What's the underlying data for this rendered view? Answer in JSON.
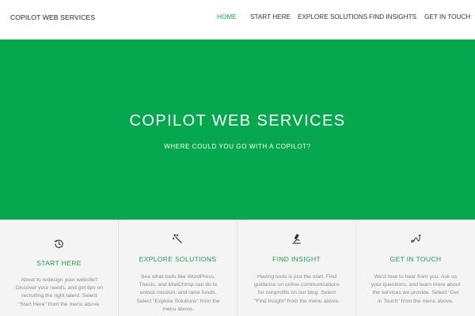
{
  "header": {
    "site_title": "COPILOT WEB SERVICES",
    "nav": [
      {
        "label": "HOME",
        "active": true
      },
      {
        "label": "START HERE",
        "active": false
      },
      {
        "label": "EXPLORE SOLUTIONS",
        "active": false
      },
      {
        "label": "FIND INSIGHTS",
        "active": false
      },
      {
        "label": "GET IN TOUCH",
        "active": false
      }
    ]
  },
  "hero": {
    "title": "COPILOT WEB SERVICES",
    "subtitle": "WHERE COULD YOU GO WITH A COPILOT?",
    "background_color": "#06a84d"
  },
  "features": [
    {
      "icon": "history-icon",
      "title": "START HERE",
      "text": "About to redesign your website? Discover your needs, and get tips on recruiting the right talent. Select \"Start Here\" from the menu above."
    },
    {
      "icon": "magic-wand-icon",
      "title": "EXPLORE SOLUTIONS",
      "text": "See what tools like WordPress, Thesis, and MailChimp can do to unlock mission, and raise funds. Select \"Explore Solutions\" from the menu above."
    },
    {
      "icon": "microscope-icon",
      "title": "FIND INSIGHT",
      "text": "Having tools is just the start. Find guidance on online communications for nonprofits on our blog. Select \"Find Insight\" from the menu above."
    },
    {
      "icon": "route-icon",
      "title": "GET IN TOUCH",
      "text": "We'd love to hear from you. Ask us your questions, and learn more about the services we provide. Select \"Get in Touch\" from the menu above."
    }
  ],
  "colors": {
    "accent": "#1aa34a",
    "hero_green": "#06a84d",
    "feature_bg": "#f3f4f3"
  }
}
